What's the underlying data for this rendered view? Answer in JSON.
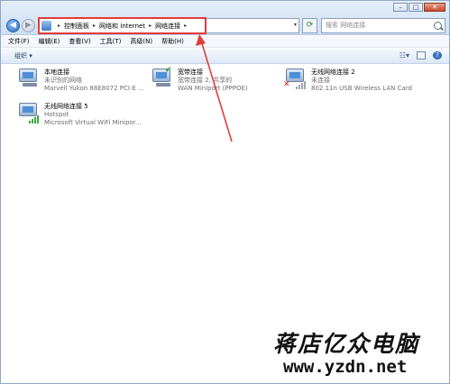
{
  "address": {
    "crumbs": [
      "控制面板",
      "网络和 Internet",
      "网络连接"
    ]
  },
  "search": {
    "placeholder": "搜索 网络连接"
  },
  "menu": [
    "文件(F)",
    "编辑(E)",
    "查看(V)",
    "工具(T)",
    "高级(N)",
    "帮助(H)"
  ],
  "command": {
    "organize": "组织 ▾"
  },
  "connections": [
    {
      "name": "本地连接",
      "status": "未识别的网络",
      "device": "Marvell Yukon 88E8072 PCI-E ..."
    },
    {
      "name": "宽带连接",
      "status": "宽带连接 2, 共享的",
      "device": "WAN Miniport (PPPOE)"
    },
    {
      "name": "无线网络连接 2",
      "status": "未连接",
      "device": "802.11n USB Wireless LAN Card"
    },
    {
      "name": "无线网络连接 5",
      "status": "Hotspot",
      "device": "Microsoft Virtual WiFi Minipor..."
    }
  ],
  "watermark": {
    "cn": "蒋店亿众电脑",
    "url": "www.yzdn.net"
  },
  "colors": {
    "highlight": "#e23b3b",
    "signal": "#3bab3b"
  }
}
